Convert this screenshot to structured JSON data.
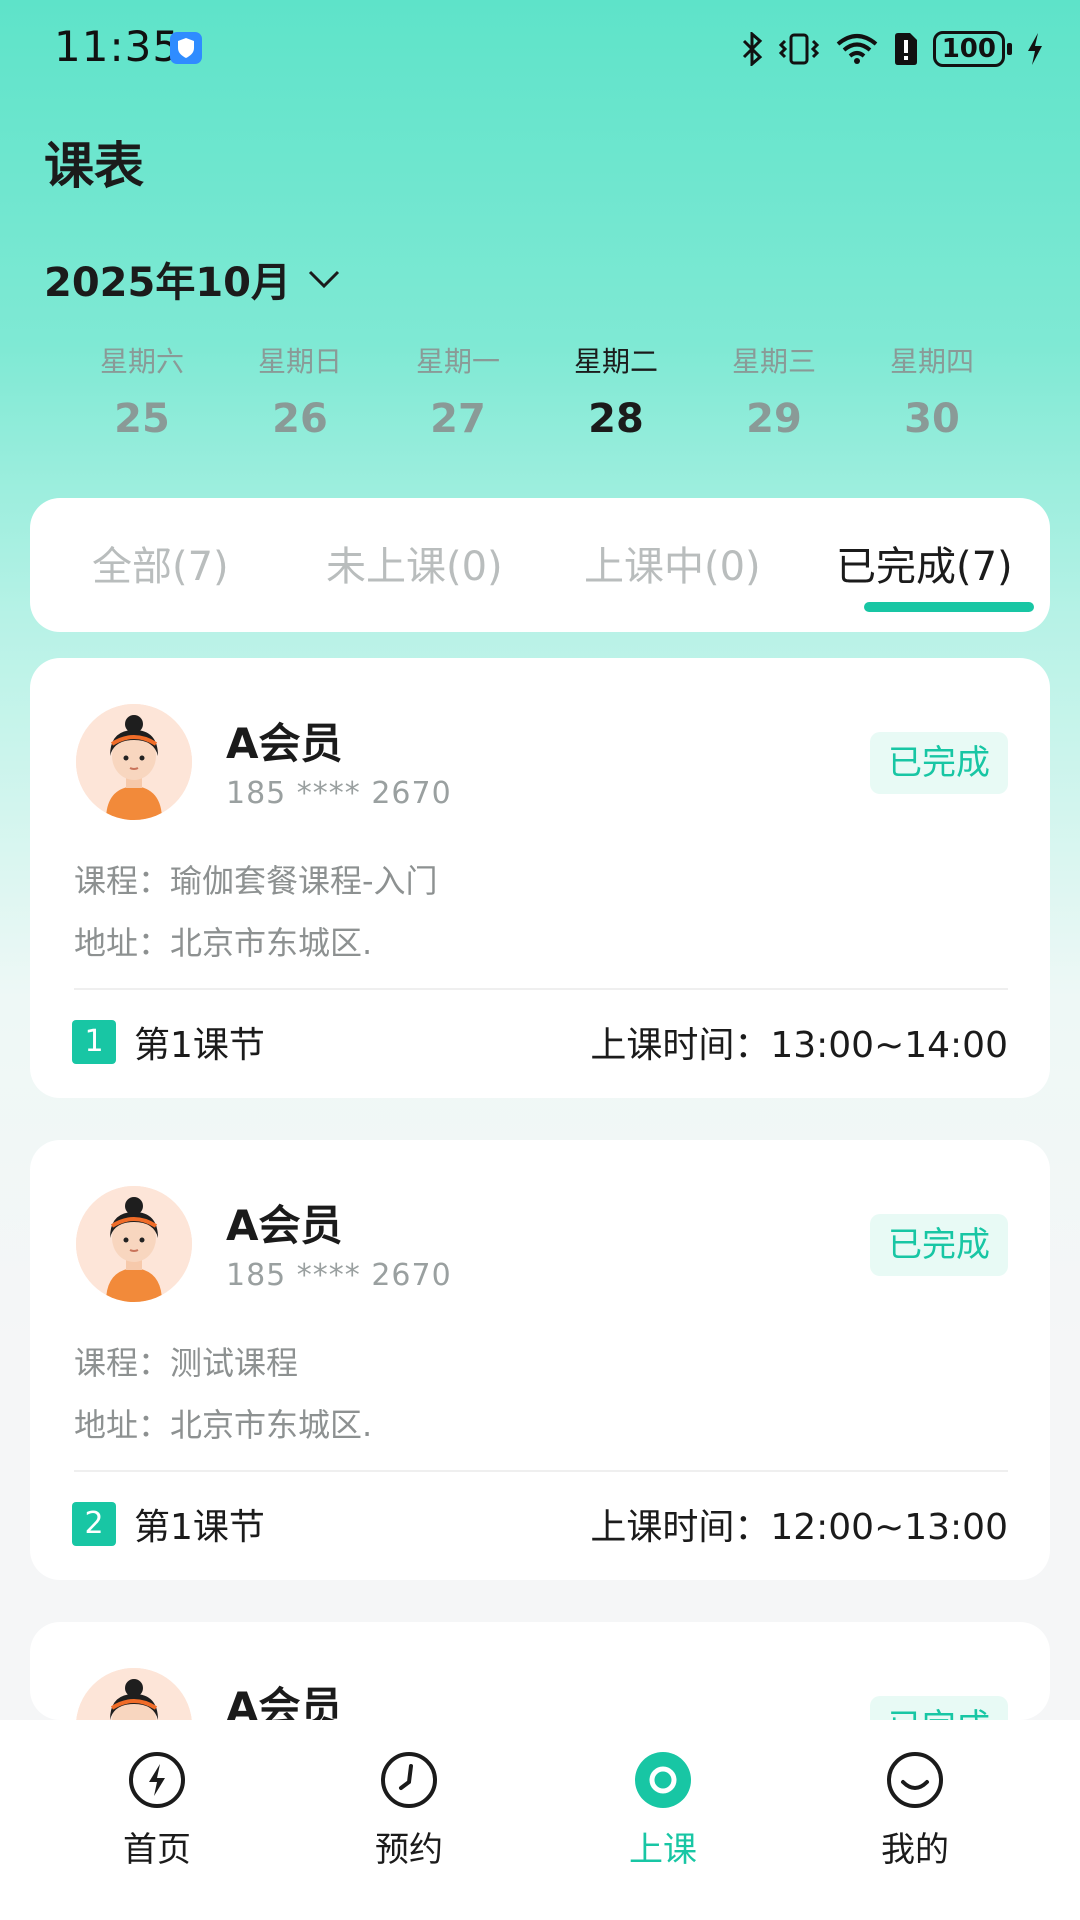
{
  "status_bar": {
    "time": "11:35",
    "battery": "100"
  },
  "header": {
    "title": "课表",
    "month": "2025年10月"
  },
  "week": [
    {
      "name": "星期六",
      "num": "25"
    },
    {
      "name": "星期日",
      "num": "26"
    },
    {
      "name": "星期一",
      "num": "27"
    },
    {
      "name": "星期二",
      "num": "28",
      "active": true
    },
    {
      "name": "星期三",
      "num": "29"
    },
    {
      "name": "星期四",
      "num": "30"
    }
  ],
  "tabs": [
    {
      "label": "全部(7)"
    },
    {
      "label": "未上课(0)"
    },
    {
      "label": "上课中(0)"
    },
    {
      "label": "已完成(7)",
      "active": true
    }
  ],
  "cards": [
    {
      "name": "A会员",
      "phone": "185 **** 2670",
      "status": "已完成",
      "course": "课程：瑜伽套餐课程-入门",
      "address": "地址：北京市东城区.",
      "index": "1",
      "lesson": "第1课节",
      "time": "上课时间：13:00~14:00"
    },
    {
      "name": "A会员",
      "phone": "185 **** 2670",
      "status": "已完成",
      "course": "课程：测试课程",
      "address": "地址：北京市东城区.",
      "index": "2",
      "lesson": "第1课节",
      "time": "上课时间：12:00~13:00"
    },
    {
      "name": "A会员",
      "status": "已完成"
    }
  ],
  "nav": [
    {
      "label": "首页",
      "icon": "bolt-icon"
    },
    {
      "label": "预约",
      "icon": "clock-icon"
    },
    {
      "label": "上课",
      "icon": "class-icon",
      "active": true
    },
    {
      "label": "我的",
      "icon": "smile-icon"
    }
  ],
  "colors": {
    "accent": "#18c6a4"
  }
}
